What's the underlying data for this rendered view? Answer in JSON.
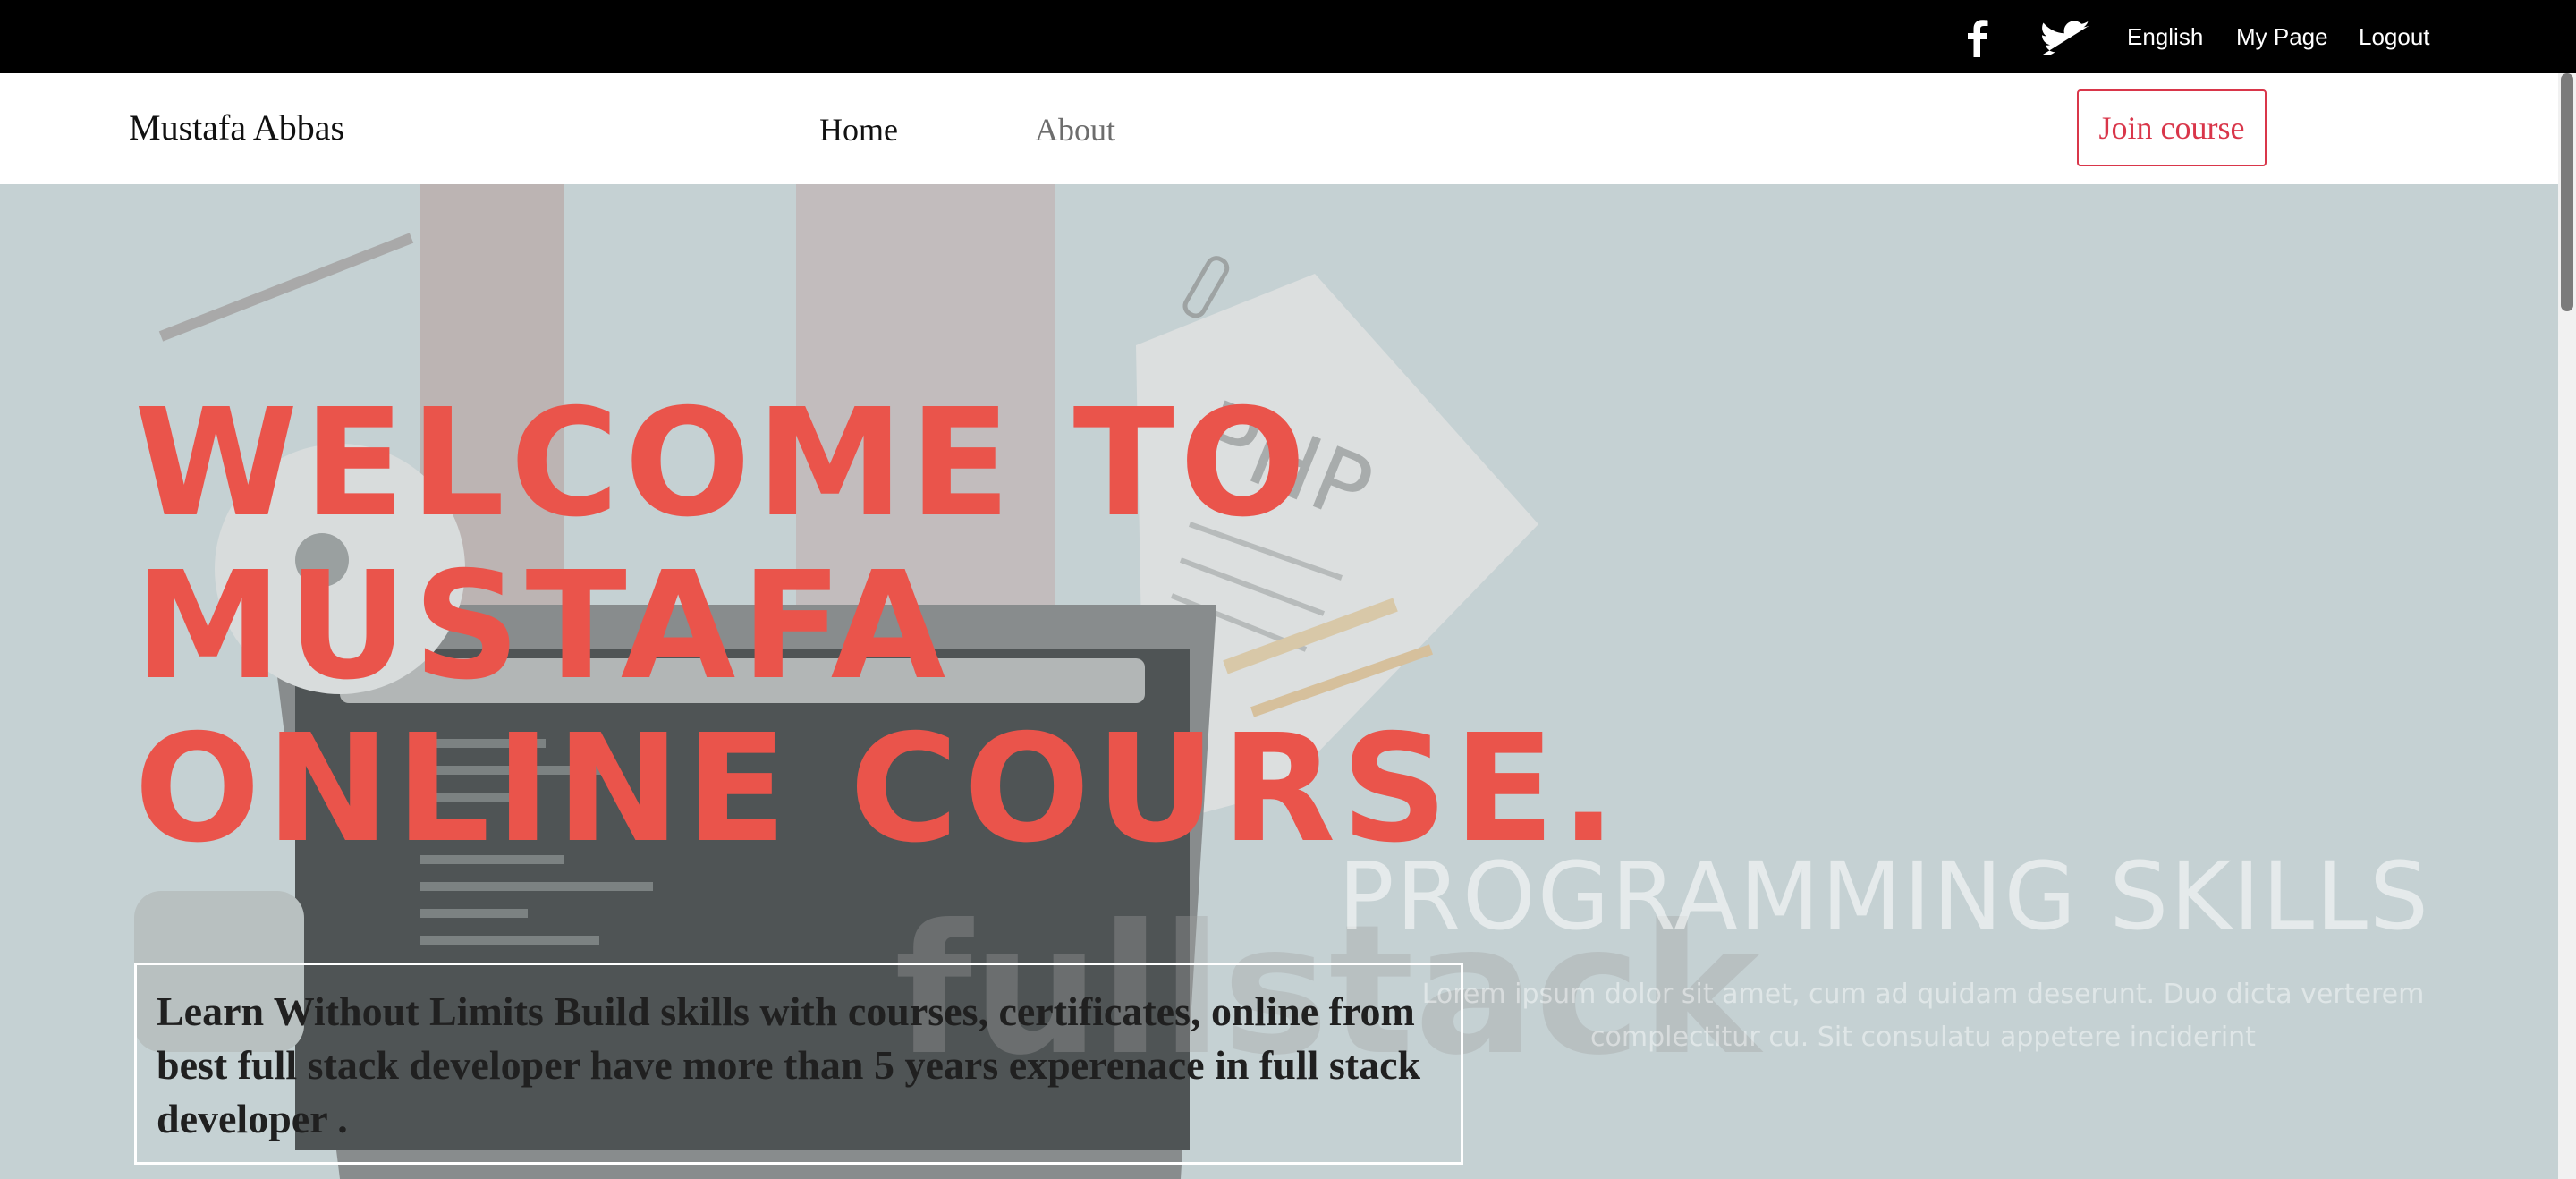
{
  "topbar": {
    "social": [
      "facebook-icon",
      "twitter-icon"
    ],
    "links": {
      "language": "English",
      "my_page": "My Page",
      "logout": "Logout"
    }
  },
  "navbar": {
    "brand": "Mustafa Abbas",
    "links": {
      "home": "Home",
      "about": "About"
    },
    "cta": "Join course"
  },
  "hero": {
    "title_lines": [
      "WELCOME TO",
      "MUSTAFA",
      "ONLINE COURSE."
    ],
    "background_title": "PROGRAMMING SKILLS",
    "background_subtitle": "Lorem ipsum dolor sit amet, cum ad quidam deserunt. Duo dicta verterem complectitur cu. Sit consulatu appetere inciderint",
    "background_art_text": "PHP",
    "description": "Learn Without Limits Build skills with courses, certificates, online from best full stack developer have more than 5 years experenace in full stack developer ."
  },
  "colors": {
    "accent": "#ea544b",
    "button": "#d9364a",
    "hero_bg": "#c5d1d3"
  }
}
